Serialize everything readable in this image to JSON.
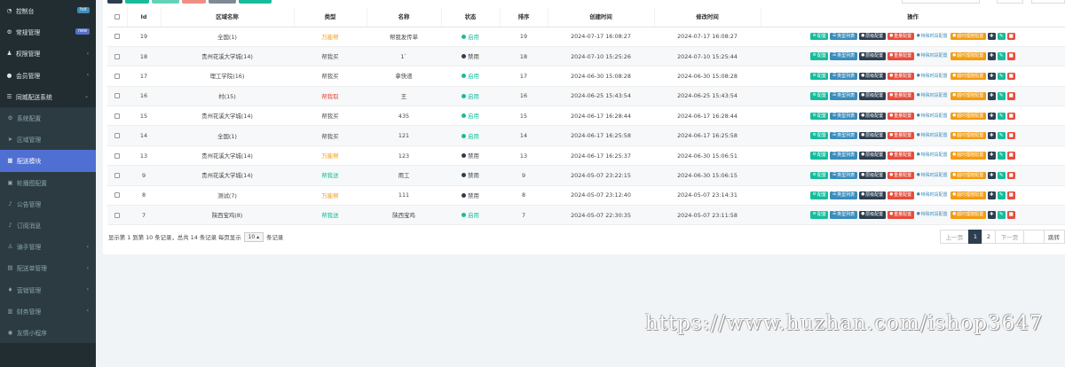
{
  "sidebar": {
    "items": [
      {
        "label": "控制台",
        "icon": "dashboard-icon",
        "level": "top",
        "badge": "hot",
        "badge_color": "#3c8dbc"
      },
      {
        "label": "常规管理",
        "icon": "gear-icon",
        "level": "top",
        "badge": "new",
        "badge_color": "#5470c6"
      },
      {
        "label": "权限管理",
        "icon": "group-icon",
        "level": "top",
        "caret": "‹"
      },
      {
        "label": "会员管理",
        "icon": "user-icon",
        "level": "top",
        "caret": "‹"
      },
      {
        "label": "同城配送系统",
        "icon": "list-icon",
        "level": "top",
        "caret": "⌄"
      },
      {
        "label": "系统配置",
        "icon": "cogs-icon",
        "level": "sub"
      },
      {
        "label": "区域管理",
        "icon": "location-icon",
        "level": "sub"
      },
      {
        "label": "配送模块",
        "icon": "grid-icon",
        "level": "sub",
        "active": true
      },
      {
        "label": "轮播图配置",
        "icon": "image-icon",
        "level": "sub"
      },
      {
        "label": "公告管理",
        "icon": "bell-icon",
        "level": "sub"
      },
      {
        "label": "订阅消息",
        "icon": "bell-icon",
        "level": "sub"
      },
      {
        "label": "骑手管理",
        "icon": "rider-icon",
        "level": "sub",
        "caret": "‹"
      },
      {
        "label": "配送单管理",
        "icon": "order-icon",
        "level": "sub",
        "caret": "‹"
      },
      {
        "label": "营销管理",
        "icon": "marketing-icon",
        "level": "sub",
        "caret": "‹"
      },
      {
        "label": "财务管理",
        "icon": "finance-icon",
        "level": "sub",
        "caret": "‹"
      },
      {
        "label": "友情小程序",
        "icon": "link-icon",
        "level": "sub"
      }
    ]
  },
  "toolbar": {
    "button_colors": [
      "#2c3e50",
      "#18bc9c",
      "#63d3b8",
      "#f08e86",
      "#7d8a96",
      "#18bc9c"
    ]
  },
  "table": {
    "columns": [
      "",
      "Id",
      "区域名称",
      "类型",
      "名称",
      "状态",
      "排序",
      "创建时间",
      "修改时间",
      "操作"
    ],
    "rows": [
      {
        "id": "19",
        "area": "全国(1)",
        "type": "万能帮",
        "type_color": "#f39c12",
        "name": "帮我发传单",
        "status": "启用",
        "status_color": "#18bc9c",
        "sort": "19",
        "created": "2024-07-17 16:08:27",
        "updated": "2024-07-17 16:08:27"
      },
      {
        "id": "18",
        "area": "贵州花溪大学城(14)",
        "type": "帮我买",
        "type_color": "#555555",
        "name": "1`",
        "status": "禁用",
        "status_color": "#2c3e50",
        "sort": "18",
        "created": "2024-07-10 15:25:26",
        "updated": "2024-07-10 15:25:44"
      },
      {
        "id": "17",
        "area": "理工学院(16)",
        "type": "帮我买",
        "type_color": "#555555",
        "name": "拿快递",
        "status": "启用",
        "status_color": "#18bc9c",
        "sort": "17",
        "created": "2024-06-30 15:08:28",
        "updated": "2024-06-30 15:08:28"
      },
      {
        "id": "16",
        "area": "村(15)",
        "type": "帮我取",
        "type_color": "#e74c3c",
        "name": "王",
        "status": "启用",
        "status_color": "#18bc9c",
        "sort": "16",
        "created": "2024-06-25 15:43:54",
        "updated": "2024-06-25 15:43:54"
      },
      {
        "id": "15",
        "area": "贵州花溪大学城(14)",
        "type": "帮我买",
        "type_color": "#555555",
        "name": "435",
        "status": "启用",
        "status_color": "#18bc9c",
        "sort": "15",
        "created": "2024-06-17 16:28:44",
        "updated": "2024-06-17 16:28:44"
      },
      {
        "id": "14",
        "area": "全国(1)",
        "type": "帮我买",
        "type_color": "#555555",
        "name": "121",
        "status": "启用",
        "status_color": "#18bc9c",
        "sort": "14",
        "created": "2024-06-17 16:25:58",
        "updated": "2024-06-17 16:25:58"
      },
      {
        "id": "13",
        "area": "贵州花溪大学城(14)",
        "type": "万能帮",
        "type_color": "#f39c12",
        "name": "123",
        "status": "禁用",
        "status_color": "#2c3e50",
        "sort": "13",
        "created": "2024-06-17 16:25:37",
        "updated": "2024-06-30 15:06:51"
      },
      {
        "id": "9",
        "area": "贵州花溪大学城(14)",
        "type": "帮我送",
        "type_color": "#18bc9c",
        "name": "用工",
        "status": "禁用",
        "status_color": "#2c3e50",
        "sort": "9",
        "created": "2024-05-07 23:22:15",
        "updated": "2024-06-30 15:06:15"
      },
      {
        "id": "8",
        "area": "测试(7)",
        "type": "万能帮",
        "type_color": "#f39c12",
        "name": "111",
        "status": "禁用",
        "status_color": "#2c3e50",
        "sort": "8",
        "created": "2024-05-07 23:12:40",
        "updated": "2024-05-07 23:14:31"
      },
      {
        "id": "7",
        "area": "陕西宝鸡(8)",
        "type": "帮我送",
        "type_color": "#18bc9c",
        "name": "陕西宝鸡",
        "status": "启用",
        "status_color": "#18bc9c",
        "sort": "7",
        "created": "2024-05-07 22:30:35",
        "updated": "2024-05-07 23:11:58"
      }
    ],
    "row_actions": [
      {
        "label": "配置",
        "icon": "cogs-icon",
        "glyph": "⚙",
        "color": "#18bc9c",
        "name": "config-button"
      },
      {
        "label": "类型列表",
        "icon": "list-icon",
        "glyph": "☰",
        "color": "#3c8dbc",
        "name": "type-list-button"
      },
      {
        "label": "层级配置",
        "icon": "circle-icon",
        "glyph": "●",
        "color": "#2c3e50",
        "name": "level-config-button"
      },
      {
        "label": "重量配置",
        "icon": "circle-icon",
        "glyph": "●",
        "color": "#e74c3c",
        "name": "weight-config-button"
      },
      {
        "label": "特殊时段配置",
        "icon": "circle-icon",
        "glyph": "●",
        "color": "transparent",
        "name": "special-period-config-button"
      },
      {
        "label": "超时理赔配置",
        "icon": "circle-icon",
        "glyph": "●",
        "color": "#f39c12",
        "name": "timeout-claim-config-button"
      }
    ],
    "icon_actions": [
      {
        "icon": "move-icon",
        "glyph": "✚",
        "color": "#2c3e50",
        "name": "drag-button"
      },
      {
        "icon": "edit-icon",
        "glyph": "✎",
        "color": "#18bc9c",
        "name": "edit-button"
      },
      {
        "icon": "trash-icon",
        "glyph": "■",
        "color": "#e74c3c",
        "name": "delete-button"
      }
    ]
  },
  "footer": {
    "info_prefix": "显示第 1 到第 10 条记录，总共 14 条记录 每页显示",
    "page_size": "10",
    "info_suffix": "条记录"
  },
  "pagination": {
    "prev": "上一页",
    "pages": [
      "1",
      "2"
    ],
    "active_page": "1",
    "next": "下一页",
    "jump": "跳转"
  },
  "watermark": "https://www.huzhan.com/ishop3647"
}
